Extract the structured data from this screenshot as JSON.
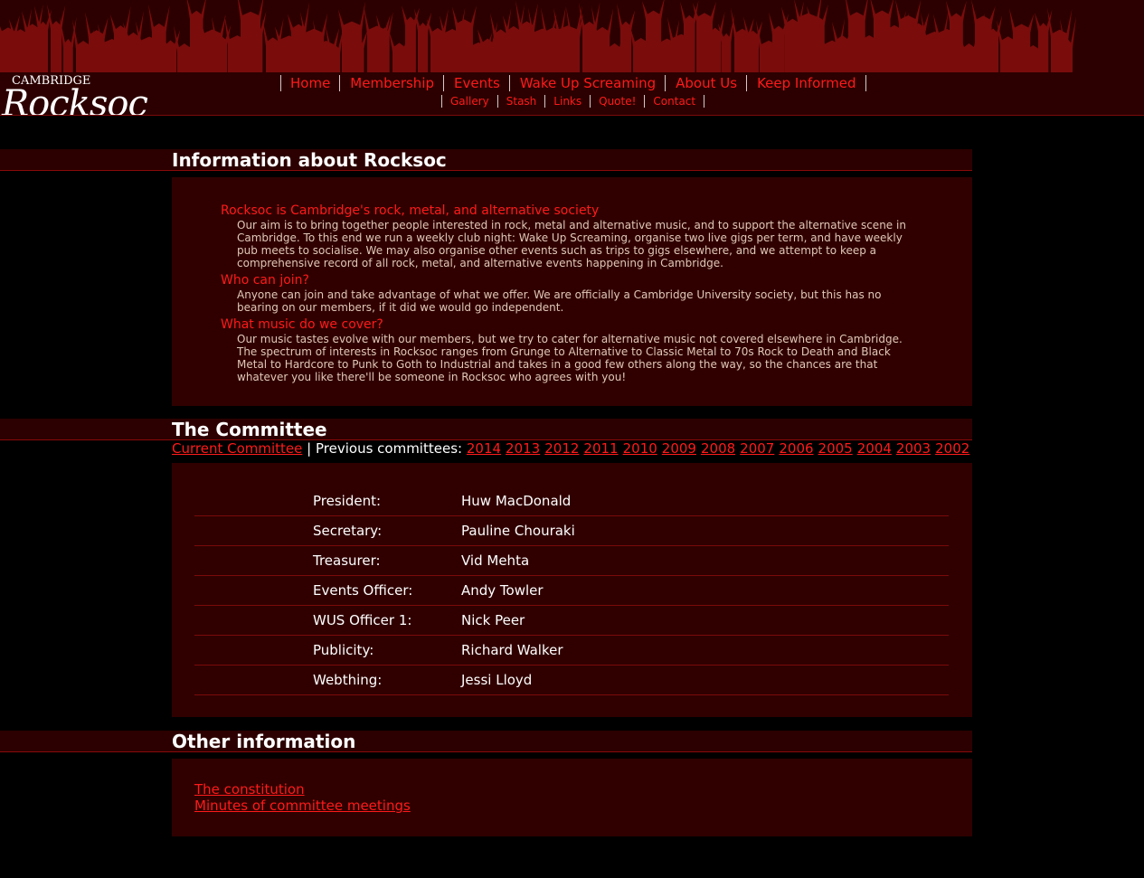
{
  "site": {
    "logo_small": "CAMBRIDGE",
    "logo_big": "Rocksoc"
  },
  "nav_main": [
    "Home",
    "Membership",
    "Events",
    "Wake Up Screaming",
    "About Us",
    "Keep Informed"
  ],
  "nav_sub": [
    "Gallery",
    "Stash",
    "Links",
    "Quote!",
    "Contact"
  ],
  "info": {
    "title": "Information about Rocksoc",
    "items": [
      {
        "q": "Rocksoc is Cambridge's rock, metal, and alternative society",
        "a": "Our aim is to bring together people interested in rock, metal and alternative music, and to support the alternative scene in Cambridge. To this end we run a weekly club night: Wake Up Screaming, organise two live gigs per term, and have weekly pub meets to socialise. We may also organise other events such as trips to gigs elsewhere, and we attempt to keep a comprehensive record of all rock, metal, and alternative events happening in Cambridge."
      },
      {
        "q": "Who can join?",
        "a": "Anyone can join and take advantage of what we offer. We are officially a Cambridge University society, but this has no bearing on our members, if it did we would go independent."
      },
      {
        "q": "What music do we cover?",
        "a": "Our music tastes evolve with our members, but we try to cater for alternative music not covered elsewhere in Cambridge. The spectrum of interests in Rocksoc ranges from Grunge to Alternative to Classic Metal to 70s Rock to Death and Black Metal to Hardcore to Punk to Goth to Industrial and takes in a good few others along the way, so the chances are that whatever you like there'll be someone in Rocksoc who agrees with you!"
      }
    ]
  },
  "committee": {
    "title": "The Committee",
    "current_label": "Current Committee",
    "separator": "|",
    "previous_label": "Previous committees:",
    "years": [
      "2014",
      "2013",
      "2012",
      "2011",
      "2010",
      "2009",
      "2008",
      "2007",
      "2006",
      "2005",
      "2004",
      "2003",
      "2002"
    ],
    "members": [
      {
        "role": "President:",
        "name": "Huw MacDonald"
      },
      {
        "role": "Secretary:",
        "name": "Pauline Chouraki"
      },
      {
        "role": "Treasurer:",
        "name": "Vid Mehta"
      },
      {
        "role": "Events Officer:",
        "name": "Andy Towler"
      },
      {
        "role": "WUS Officer 1:",
        "name": "Nick Peer"
      },
      {
        "role": "Publicity:",
        "name": "Richard Walker"
      },
      {
        "role": "Webthing:",
        "name": "Jessi Lloyd"
      }
    ]
  },
  "other": {
    "title": "Other information",
    "links": [
      "The constitution",
      "Minutes of committee meetings"
    ]
  },
  "colors": {
    "accent": "#ff1a1a",
    "panel": "#300000",
    "header": "#2c0000",
    "background": "#000000"
  }
}
